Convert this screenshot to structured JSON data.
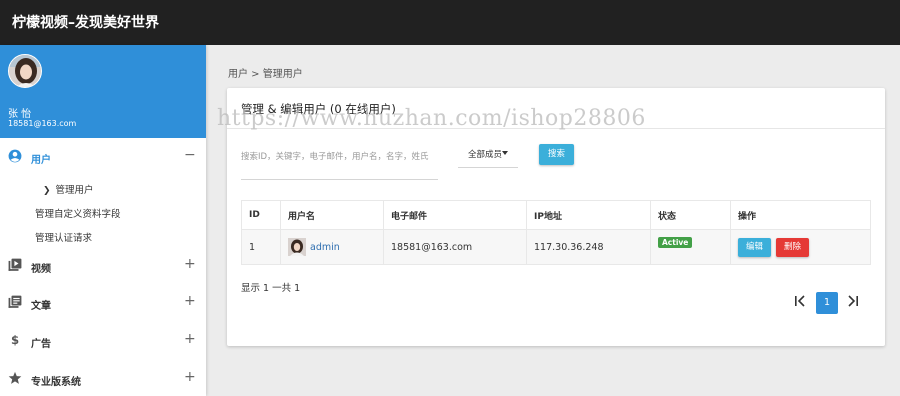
{
  "app": {
    "title": "柠檬视频–发现美好世界"
  },
  "profile": {
    "name": "张 怡",
    "email": "18581@163.com",
    "avatar_icon": "avatar-portrait"
  },
  "sidebar": {
    "groups": [
      {
        "label": "用户",
        "toggle": "−",
        "icon": "account-circle-icon",
        "active": true
      },
      {
        "label": "视频",
        "toggle": "+",
        "icon": "video-library-icon"
      },
      {
        "label": "文章",
        "toggle": "+",
        "icon": "article-icon"
      },
      {
        "label": "广告",
        "toggle": "+",
        "icon": "dollar-icon"
      },
      {
        "label": "专业版系统",
        "toggle": "+",
        "icon": "star-icon"
      }
    ],
    "user_subitems": [
      {
        "label": "管理用户",
        "active": true
      },
      {
        "label": "管理自定义资料字段"
      },
      {
        "label": "管理认证请求"
      }
    ]
  },
  "breadcrumb": {
    "text": "用户 > 管理用户"
  },
  "card": {
    "title": "管理 & 编辑用户 (0 在线用户)",
    "search_placeholder": "搜索ID，关键字，电子邮件，用户名，名字，姓氏",
    "filter_selected": "全部成员",
    "search_button": "搜索"
  },
  "table": {
    "columns": [
      "ID",
      "用户名",
      "电子邮件",
      "IP地址",
      "状态",
      "操作"
    ],
    "rows": [
      {
        "id": "1",
        "username": "admin",
        "email": "18581@163.com",
        "ip": "117.30.36.248",
        "status": "Active",
        "edit": "编辑",
        "delete": "删除"
      }
    ]
  },
  "footer": {
    "showing": "显示 1 一共 1",
    "current_page": "1"
  },
  "watermark": {
    "text": "https://www.huzhan.com/ishop28806"
  },
  "colors": {
    "topbar": "#212121",
    "primary": "#2f8fd9",
    "info_button": "#3bafda",
    "danger": "#e53935",
    "success": "#43a047"
  }
}
